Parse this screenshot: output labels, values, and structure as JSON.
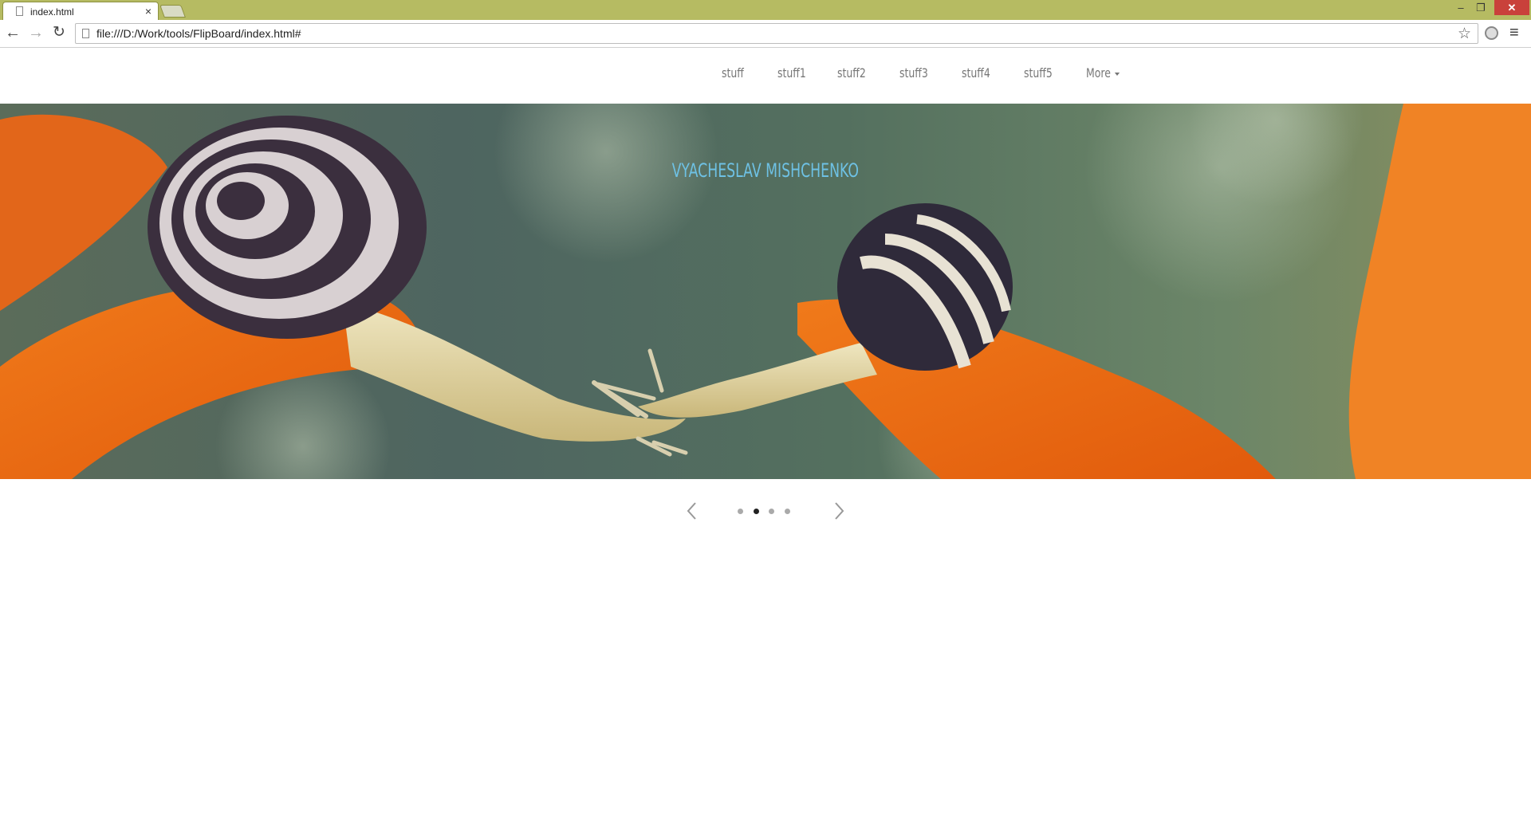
{
  "browser": {
    "tab_title": "index.html",
    "tab_close": "×",
    "url": "file:///D:/Work/tools/FlipBoard/index.html#",
    "icons": [
      "back-icon",
      "forward-icon",
      "reload-icon",
      "page-icon",
      "star-icon",
      "extension-icon",
      "menu-icon",
      "minimize-icon",
      "restore-icon",
      "close-icon"
    ]
  },
  "nav": {
    "items": [
      "stuff",
      "stuff1",
      "stuff2",
      "stuff3",
      "stuff4",
      "stuff5"
    ],
    "more": "More"
  },
  "slider": {
    "caption": "VYACHESLAV MISHCHENKO",
    "slide_count": 4,
    "active_slide": 2,
    "caption_color": "#6ec1e4"
  }
}
